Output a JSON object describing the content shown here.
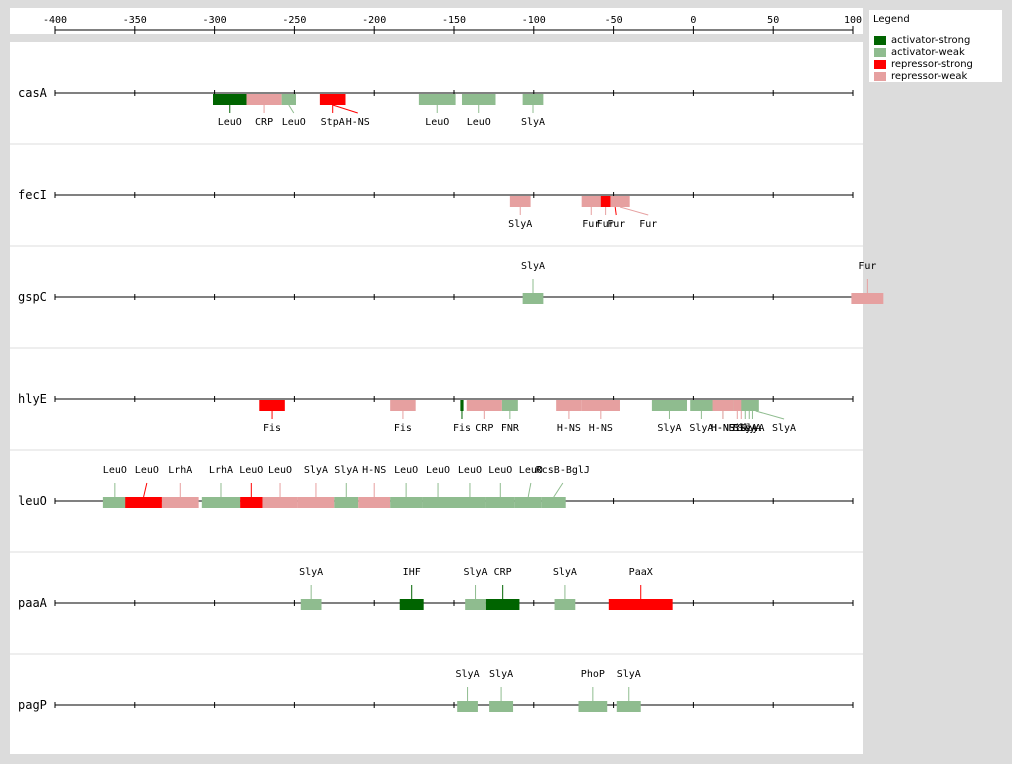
{
  "axis": {
    "min": -400,
    "max": 100,
    "ticks": [
      -400,
      -350,
      -300,
      -250,
      -200,
      -150,
      -100,
      -50,
      0,
      50,
      100
    ]
  },
  "legend": {
    "title": "Legend",
    "items": [
      {
        "key": "activator-strong",
        "label": "activator-strong",
        "color": "#006400"
      },
      {
        "key": "activator-weak",
        "label": "activator-weak",
        "color": "#8fbc8f"
      },
      {
        "key": "repressor-strong",
        "label": "repressor-strong",
        "color": "#ff0000"
      },
      {
        "key": "repressor-weak",
        "label": "repressor-weak",
        "color": "#e6a0a0"
      }
    ]
  },
  "tracks": [
    {
      "gene": "casA",
      "sites": [
        {
          "start": -301,
          "end": -280,
          "type": "activator-strong",
          "label": "LeuO",
          "side": "below"
        },
        {
          "start": -280,
          "end": -258,
          "type": "repressor-weak",
          "label": "CRP",
          "side": "below"
        },
        {
          "start": -258,
          "end": -249,
          "type": "activator-weak",
          "label": "LeuO",
          "side": "below"
        },
        {
          "start": -234,
          "end": -218,
          "type": "repressor-strong",
          "label": "StpA",
          "side": "below"
        },
        {
          "start": -234,
          "end": -218,
          "type": "repressor-strong",
          "label": "H-NS",
          "side": "below"
        },
        {
          "start": -172,
          "end": -149,
          "type": "activator-weak",
          "label": "LeuO",
          "side": "below"
        },
        {
          "start": -145,
          "end": -124,
          "type": "activator-weak",
          "label": "LeuO",
          "side": "below"
        },
        {
          "start": -107,
          "end": -94,
          "type": "activator-weak",
          "label": "SlyA",
          "side": "below"
        }
      ]
    },
    {
      "gene": "fecI",
      "sites": [
        {
          "start": -115,
          "end": -102,
          "type": "repressor-weak",
          "label": "SlyA",
          "side": "below"
        },
        {
          "start": -70,
          "end": -58,
          "type": "repressor-weak",
          "label": "Fur",
          "side": "below"
        },
        {
          "start": -64,
          "end": -46,
          "type": "repressor-weak",
          "label": "Fur",
          "side": "below"
        },
        {
          "start": -58,
          "end": -40,
          "type": "repressor-strong",
          "label": "Fur",
          "side": "below"
        },
        {
          "start": -52,
          "end": -40,
          "type": "repressor-weak",
          "label": "Fur",
          "side": "below"
        }
      ]
    },
    {
      "gene": "gspC",
      "sites": [
        {
          "start": -107,
          "end": -94,
          "type": "activator-weak",
          "label": "SlyA",
          "side": "above"
        },
        {
          "start": 99,
          "end": 119,
          "type": "repressor-weak",
          "label": "Fur",
          "side": "above"
        }
      ]
    },
    {
      "gene": "hlyE",
      "sites": [
        {
          "start": -272,
          "end": -256,
          "type": "repressor-strong",
          "label": "Fis",
          "side": "below"
        },
        {
          "start": -190,
          "end": -174,
          "type": "repressor-weak",
          "label": "Fis",
          "side": "below"
        },
        {
          "start": -146,
          "end": -144,
          "type": "activator-strong",
          "label": "Fis",
          "side": "below"
        },
        {
          "start": -142,
          "end": -120,
          "type": "repressor-weak",
          "label": "CRP",
          "side": "below"
        },
        {
          "start": -120,
          "end": -110,
          "type": "activator-weak",
          "label": "FNR",
          "side": "below"
        },
        {
          "start": -86,
          "end": -70,
          "type": "repressor-weak",
          "label": "H-NS",
          "side": "below"
        },
        {
          "start": -70,
          "end": -46,
          "type": "repressor-weak",
          "label": "H-NS",
          "side": "below"
        },
        {
          "start": -26,
          "end": -4,
          "type": "activator-weak",
          "label": "SlyA",
          "side": "below"
        },
        {
          "start": -2,
          "end": 12,
          "type": "activator-weak",
          "label": "SlyA",
          "side": "below"
        },
        {
          "start": 12,
          "end": 25,
          "type": "activator-weak",
          "label": "H-NS",
          "side": "below"
        },
        {
          "start": 12,
          "end": 25,
          "type": "repressor-weak",
          "label": "H-NS",
          "side": "below"
        },
        {
          "start": 25,
          "end": 30,
          "type": "repressor-weak",
          "label": "Fis",
          "side": "below"
        },
        {
          "start": 28,
          "end": 32,
          "type": "repressor-weak",
          "label": "Fis",
          "side": "below"
        },
        {
          "start": 30,
          "end": 35,
          "type": "activator-weak",
          "label": "SlyA",
          "side": "below"
        },
        {
          "start": 33,
          "end": 37,
          "type": "activator-weak",
          "label": "SlyA",
          "side": "below"
        },
        {
          "start": 35,
          "end": 39,
          "type": "activator-weak",
          "label": "SlyA",
          "side": "below"
        },
        {
          "start": 37,
          "end": 41,
          "type": "activator-weak",
          "label": "SlyA",
          "side": "below"
        }
      ]
    },
    {
      "gene": "leuO",
      "sites": [
        {
          "start": -370,
          "end": -355,
          "type": "activator-weak",
          "label": "LeuO",
          "side": "above"
        },
        {
          "start": -356,
          "end": -333,
          "type": "repressor-strong",
          "label": "LeuO",
          "side": "above"
        },
        {
          "start": -333,
          "end": -310,
          "type": "repressor-weak",
          "label": "LrhA",
          "side": "above"
        },
        {
          "start": -308,
          "end": -284,
          "type": "activator-weak",
          "label": "LrhA",
          "side": "above"
        },
        {
          "start": -284,
          "end": -270,
          "type": "repressor-strong",
          "label": "LeuO",
          "side": "above"
        },
        {
          "start": -270,
          "end": -248,
          "type": "repressor-weak",
          "label": "LeuO",
          "side": "above"
        },
        {
          "start": -248,
          "end": -225,
          "type": "repressor-weak",
          "label": "SlyA",
          "side": "above"
        },
        {
          "start": -225,
          "end": -210,
          "type": "activator-weak",
          "label": "SlyA",
          "side": "above"
        },
        {
          "start": -210,
          "end": -190,
          "type": "repressor-weak",
          "label": "H-NS",
          "side": "above"
        },
        {
          "start": -190,
          "end": -170,
          "type": "activator-weak",
          "label": "LeuO",
          "side": "above"
        },
        {
          "start": -170,
          "end": -150,
          "type": "activator-weak",
          "label": "LeuO",
          "side": "above"
        },
        {
          "start": -150,
          "end": -130,
          "type": "activator-weak",
          "label": "LeuO",
          "side": "above"
        },
        {
          "start": -130,
          "end": -112,
          "type": "activator-weak",
          "label": "LeuO",
          "side": "above"
        },
        {
          "start": -112,
          "end": -95,
          "type": "activator-weak",
          "label": "LeuO",
          "side": "above"
        },
        {
          "start": -95,
          "end": -80,
          "type": "activator-weak",
          "label": "RcsB-BglJ",
          "side": "above"
        }
      ]
    },
    {
      "gene": "paaA",
      "sites": [
        {
          "start": -246,
          "end": -233,
          "type": "activator-weak",
          "label": "SlyA",
          "side": "above"
        },
        {
          "start": -184,
          "end": -169,
          "type": "activator-strong",
          "label": "IHF",
          "side": "above"
        },
        {
          "start": -143,
          "end": -130,
          "type": "activator-weak",
          "label": "SlyA",
          "side": "above"
        },
        {
          "start": -130,
          "end": -109,
          "type": "activator-strong",
          "label": "CRP",
          "side": "above"
        },
        {
          "start": -87,
          "end": -74,
          "type": "activator-weak",
          "label": "SlyA",
          "side": "above"
        },
        {
          "start": -53,
          "end": -13,
          "type": "repressor-strong",
          "label": "PaaX",
          "side": "above"
        }
      ]
    },
    {
      "gene": "pagP",
      "sites": [
        {
          "start": -148,
          "end": -135,
          "type": "activator-weak",
          "label": "SlyA",
          "side": "above"
        },
        {
          "start": -128,
          "end": -113,
          "type": "activator-weak",
          "label": "SlyA",
          "side": "above"
        },
        {
          "start": -72,
          "end": -54,
          "type": "activator-weak",
          "label": "PhoP",
          "side": "above"
        },
        {
          "start": -48,
          "end": -33,
          "type": "activator-weak",
          "label": "SlyA",
          "side": "above"
        }
      ]
    }
  ]
}
